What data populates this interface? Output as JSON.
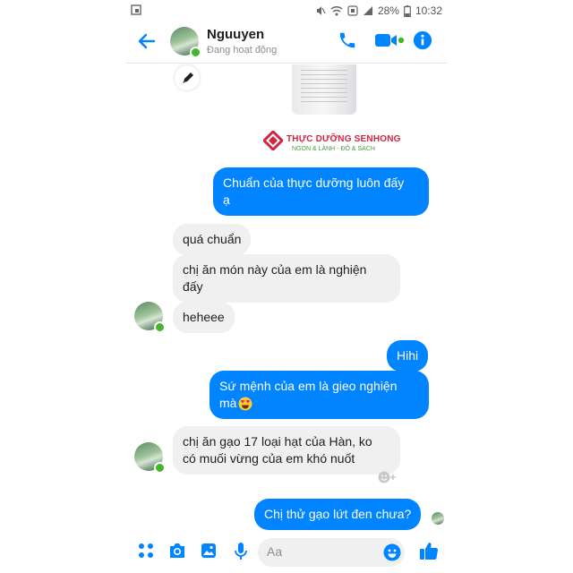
{
  "status_bar": {
    "battery": "28%",
    "time": "10:32"
  },
  "header": {
    "name": "Nguuyen",
    "status": "Đang hoạt động"
  },
  "shared_image": {
    "brand": "THỰC DƯỠNG SENHONG",
    "slogan": "NGON & LÀNH - ĐỎ & SẠCH"
  },
  "messages": [
    {
      "id": "m1",
      "side": "out",
      "lines": [
        "Chuẩn của thực dưỡng luôn đấy",
        "ạ"
      ]
    },
    {
      "id": "m2",
      "side": "in",
      "lines": [
        "quá chuẩn"
      ]
    },
    {
      "id": "m3",
      "side": "in",
      "lines": [
        "chị ăn món này của em là nghiện",
        "đấy"
      ]
    },
    {
      "id": "m4",
      "side": "in",
      "lines": [
        "heheee"
      ]
    },
    {
      "id": "m5",
      "side": "out",
      "lines": [
        "Hihi"
      ]
    },
    {
      "id": "m6",
      "side": "out",
      "lines": [
        "Sứ mệnh của em là gieo nghiện",
        "mà"
      ]
    },
    {
      "id": "m7",
      "side": "in",
      "lines": [
        "chị ăn gạo 17 loại hạt của Hàn, ko",
        "có muối vừng của em khó nuốt"
      ]
    },
    {
      "id": "m8",
      "side": "out",
      "lines": [
        "Chị thử gạo lứt đen chưa?"
      ]
    }
  ],
  "composer": {
    "placeholder": "Aa"
  },
  "colors": {
    "accent": "#0084ff",
    "incoming_bubble": "#f0f0f0",
    "online": "#42b72a"
  },
  "icons": [
    "back-arrow-icon",
    "phone-icon",
    "video-camera-icon",
    "info-icon",
    "pencil-icon",
    "apps-icon",
    "camera-icon",
    "gallery-icon",
    "microphone-icon",
    "emoji-icon",
    "like-icon"
  ]
}
